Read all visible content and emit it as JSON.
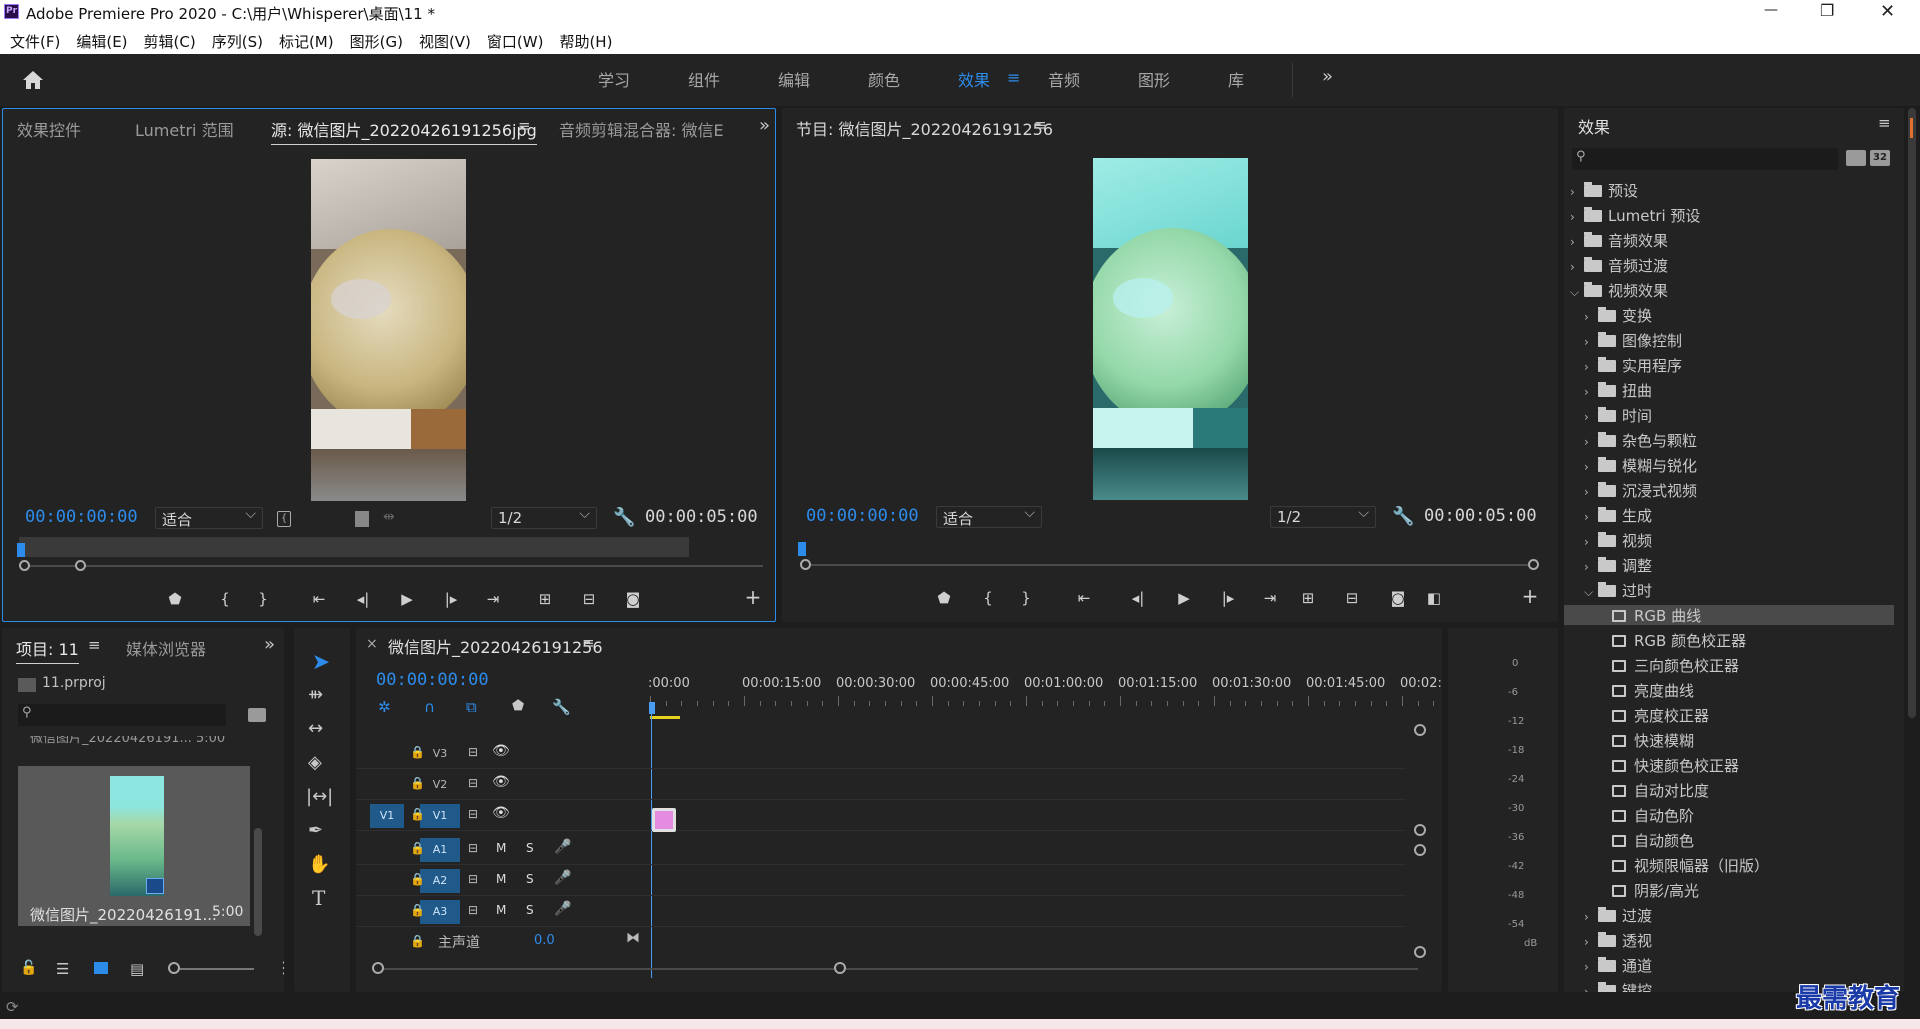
{
  "window": {
    "title": "Adobe Premiere Pro 2020 - C:\\用户\\Whisperer\\桌面\\11 *",
    "app_icon": "Pr",
    "minimize": "—",
    "restore": "❐",
    "close": "✕"
  },
  "menu": [
    "文件(F)",
    "编辑(E)",
    "剪辑(C)",
    "序列(S)",
    "标记(M)",
    "图形(G)",
    "视图(V)",
    "窗口(W)",
    "帮助(H)"
  ],
  "workspaces": {
    "tabs": [
      "学习",
      "组件",
      "编辑",
      "颜色",
      "效果",
      "音频",
      "图形",
      "库"
    ],
    "active": "效果",
    "more": "»"
  },
  "source_panel": {
    "tabs": [
      "效果控件",
      "Lumetri 范围",
      "源: 微信图片_20220426191256jpg",
      "音频剪辑混合器: 微信E"
    ],
    "active_tab": "源: 微信图片_20220426191256jpg",
    "menu_glyph": "≡",
    "more": "»",
    "timecode": "00:00:00:00",
    "fit": "适合",
    "resolution": "1/2",
    "duration": "00:00:05:00"
  },
  "program_panel": {
    "title": "节目: 微信图片_20220426191256",
    "menu_glyph": "≡",
    "timecode": "00:00:00:00",
    "fit": "适合",
    "resolution": "1/2",
    "duration": "00:00:05:00"
  },
  "effects_panel": {
    "title": "效果",
    "menu_glyph": "≡",
    "search_placeholder": "",
    "btn_32": "32",
    "top_items": [
      "预设",
      "Lumetri 预设",
      "音频效果",
      "音频过渡",
      "视频效果"
    ],
    "video_effects_children": [
      "变换",
      "图像控制",
      "实用程序",
      "扭曲",
      "时间",
      "杂色与颗粒",
      "模糊与锐化",
      "沉浸式视频",
      "生成",
      "视频",
      "调整",
      "过时"
    ],
    "obsolete_children": [
      "RGB 曲线",
      "RGB 颜色校正器",
      "三向颜色校正器",
      "亮度曲线",
      "亮度校正器",
      "快速模糊",
      "快速颜色校正器",
      "自动对比度",
      "自动色阶",
      "自动颜色",
      "视频限幅器（旧版）",
      "阴影/高光"
    ],
    "selected": "RGB 曲线",
    "bottom_items": [
      "过渡",
      "透视",
      "通道",
      "键控"
    ]
  },
  "project_panel": {
    "tabs": [
      "项目: 11",
      "媒体浏览器"
    ],
    "menu_glyph": "≡",
    "more": "»",
    "project_file": "11.prproj",
    "clip_name_partial": "微信图片_20220426191... 5:00",
    "clip_name": "微信图片_20220426191...",
    "clip_duration": "5:00"
  },
  "timeline": {
    "close": "×",
    "title": "微信图片_20220426191256",
    "menu_glyph": "≡",
    "timecode": "00:00:00:00",
    "ruler": [
      ":00:00",
      "00:00:15:00",
      "00:00:30:00",
      "00:00:45:00",
      "00:01:00:00",
      "00:01:15:00",
      "00:01:30:00",
      "00:01:45:00",
      "00:02:0"
    ],
    "video_tracks": [
      "V3",
      "V2",
      "V1"
    ],
    "source_patch": "V1",
    "audio_tracks": [
      "A1",
      "A2",
      "A3"
    ],
    "mute": "M",
    "solo": "S",
    "master_label": "主声道",
    "master_value": "0.0"
  },
  "meter": {
    "scale": [
      "0",
      "-6",
      "-12",
      "-18",
      "-24",
      "-30",
      "-36",
      "-42",
      "-48",
      "-54"
    ],
    "unit": "dB"
  },
  "tools": {
    "type": "T"
  },
  "watermark": "最需教育",
  "colors": {
    "accent": "#2d8ceb",
    "track_blue": "#1f5a8a",
    "clip_pink": "#e38ce0",
    "playhead": "#4a9cf0"
  }
}
